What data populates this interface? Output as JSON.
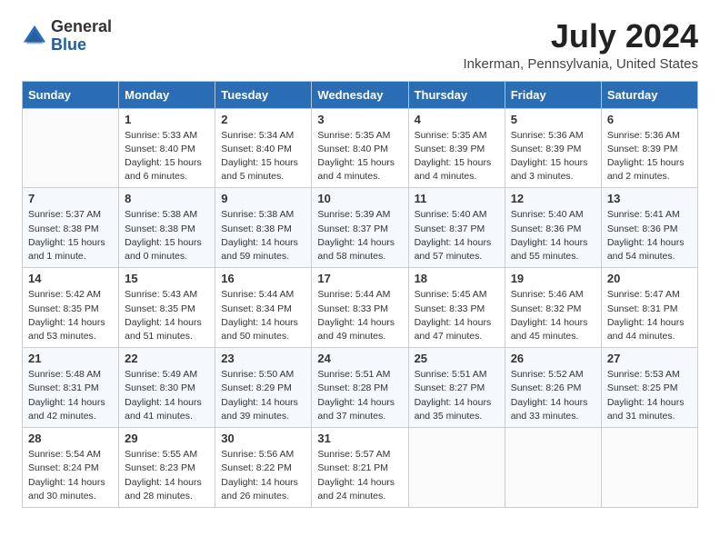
{
  "header": {
    "logo_general": "General",
    "logo_blue": "Blue",
    "month_title": "July 2024",
    "location": "Inkerman, Pennsylvania, United States"
  },
  "weekdays": [
    "Sunday",
    "Monday",
    "Tuesday",
    "Wednesday",
    "Thursday",
    "Friday",
    "Saturday"
  ],
  "weeks": [
    [
      {
        "day": "",
        "sunrise": "",
        "sunset": "",
        "daylight": ""
      },
      {
        "day": "1",
        "sunrise": "Sunrise: 5:33 AM",
        "sunset": "Sunset: 8:40 PM",
        "daylight": "Daylight: 15 hours and 6 minutes."
      },
      {
        "day": "2",
        "sunrise": "Sunrise: 5:34 AM",
        "sunset": "Sunset: 8:40 PM",
        "daylight": "Daylight: 15 hours and 5 minutes."
      },
      {
        "day": "3",
        "sunrise": "Sunrise: 5:35 AM",
        "sunset": "Sunset: 8:40 PM",
        "daylight": "Daylight: 15 hours and 4 minutes."
      },
      {
        "day": "4",
        "sunrise": "Sunrise: 5:35 AM",
        "sunset": "Sunset: 8:39 PM",
        "daylight": "Daylight: 15 hours and 4 minutes."
      },
      {
        "day": "5",
        "sunrise": "Sunrise: 5:36 AM",
        "sunset": "Sunset: 8:39 PM",
        "daylight": "Daylight: 15 hours and 3 minutes."
      },
      {
        "day": "6",
        "sunrise": "Sunrise: 5:36 AM",
        "sunset": "Sunset: 8:39 PM",
        "daylight": "Daylight: 15 hours and 2 minutes."
      }
    ],
    [
      {
        "day": "7",
        "sunrise": "Sunrise: 5:37 AM",
        "sunset": "Sunset: 8:38 PM",
        "daylight": "Daylight: 15 hours and 1 minute."
      },
      {
        "day": "8",
        "sunrise": "Sunrise: 5:38 AM",
        "sunset": "Sunset: 8:38 PM",
        "daylight": "Daylight: 15 hours and 0 minutes."
      },
      {
        "day": "9",
        "sunrise": "Sunrise: 5:38 AM",
        "sunset": "Sunset: 8:38 PM",
        "daylight": "Daylight: 14 hours and 59 minutes."
      },
      {
        "day": "10",
        "sunrise": "Sunrise: 5:39 AM",
        "sunset": "Sunset: 8:37 PM",
        "daylight": "Daylight: 14 hours and 58 minutes."
      },
      {
        "day": "11",
        "sunrise": "Sunrise: 5:40 AM",
        "sunset": "Sunset: 8:37 PM",
        "daylight": "Daylight: 14 hours and 57 minutes."
      },
      {
        "day": "12",
        "sunrise": "Sunrise: 5:40 AM",
        "sunset": "Sunset: 8:36 PM",
        "daylight": "Daylight: 14 hours and 55 minutes."
      },
      {
        "day": "13",
        "sunrise": "Sunrise: 5:41 AM",
        "sunset": "Sunset: 8:36 PM",
        "daylight": "Daylight: 14 hours and 54 minutes."
      }
    ],
    [
      {
        "day": "14",
        "sunrise": "Sunrise: 5:42 AM",
        "sunset": "Sunset: 8:35 PM",
        "daylight": "Daylight: 14 hours and 53 minutes."
      },
      {
        "day": "15",
        "sunrise": "Sunrise: 5:43 AM",
        "sunset": "Sunset: 8:35 PM",
        "daylight": "Daylight: 14 hours and 51 minutes."
      },
      {
        "day": "16",
        "sunrise": "Sunrise: 5:44 AM",
        "sunset": "Sunset: 8:34 PM",
        "daylight": "Daylight: 14 hours and 50 minutes."
      },
      {
        "day": "17",
        "sunrise": "Sunrise: 5:44 AM",
        "sunset": "Sunset: 8:33 PM",
        "daylight": "Daylight: 14 hours and 49 minutes."
      },
      {
        "day": "18",
        "sunrise": "Sunrise: 5:45 AM",
        "sunset": "Sunset: 8:33 PM",
        "daylight": "Daylight: 14 hours and 47 minutes."
      },
      {
        "day": "19",
        "sunrise": "Sunrise: 5:46 AM",
        "sunset": "Sunset: 8:32 PM",
        "daylight": "Daylight: 14 hours and 45 minutes."
      },
      {
        "day": "20",
        "sunrise": "Sunrise: 5:47 AM",
        "sunset": "Sunset: 8:31 PM",
        "daylight": "Daylight: 14 hours and 44 minutes."
      }
    ],
    [
      {
        "day": "21",
        "sunrise": "Sunrise: 5:48 AM",
        "sunset": "Sunset: 8:31 PM",
        "daylight": "Daylight: 14 hours and 42 minutes."
      },
      {
        "day": "22",
        "sunrise": "Sunrise: 5:49 AM",
        "sunset": "Sunset: 8:30 PM",
        "daylight": "Daylight: 14 hours and 41 minutes."
      },
      {
        "day": "23",
        "sunrise": "Sunrise: 5:50 AM",
        "sunset": "Sunset: 8:29 PM",
        "daylight": "Daylight: 14 hours and 39 minutes."
      },
      {
        "day": "24",
        "sunrise": "Sunrise: 5:51 AM",
        "sunset": "Sunset: 8:28 PM",
        "daylight": "Daylight: 14 hours and 37 minutes."
      },
      {
        "day": "25",
        "sunrise": "Sunrise: 5:51 AM",
        "sunset": "Sunset: 8:27 PM",
        "daylight": "Daylight: 14 hours and 35 minutes."
      },
      {
        "day": "26",
        "sunrise": "Sunrise: 5:52 AM",
        "sunset": "Sunset: 8:26 PM",
        "daylight": "Daylight: 14 hours and 33 minutes."
      },
      {
        "day": "27",
        "sunrise": "Sunrise: 5:53 AM",
        "sunset": "Sunset: 8:25 PM",
        "daylight": "Daylight: 14 hours and 31 minutes."
      }
    ],
    [
      {
        "day": "28",
        "sunrise": "Sunrise: 5:54 AM",
        "sunset": "Sunset: 8:24 PM",
        "daylight": "Daylight: 14 hours and 30 minutes."
      },
      {
        "day": "29",
        "sunrise": "Sunrise: 5:55 AM",
        "sunset": "Sunset: 8:23 PM",
        "daylight": "Daylight: 14 hours and 28 minutes."
      },
      {
        "day": "30",
        "sunrise": "Sunrise: 5:56 AM",
        "sunset": "Sunset: 8:22 PM",
        "daylight": "Daylight: 14 hours and 26 minutes."
      },
      {
        "day": "31",
        "sunrise": "Sunrise: 5:57 AM",
        "sunset": "Sunset: 8:21 PM",
        "daylight": "Daylight: 14 hours and 24 minutes."
      },
      {
        "day": "",
        "sunrise": "",
        "sunset": "",
        "daylight": ""
      },
      {
        "day": "",
        "sunrise": "",
        "sunset": "",
        "daylight": ""
      },
      {
        "day": "",
        "sunrise": "",
        "sunset": "",
        "daylight": ""
      }
    ]
  ]
}
